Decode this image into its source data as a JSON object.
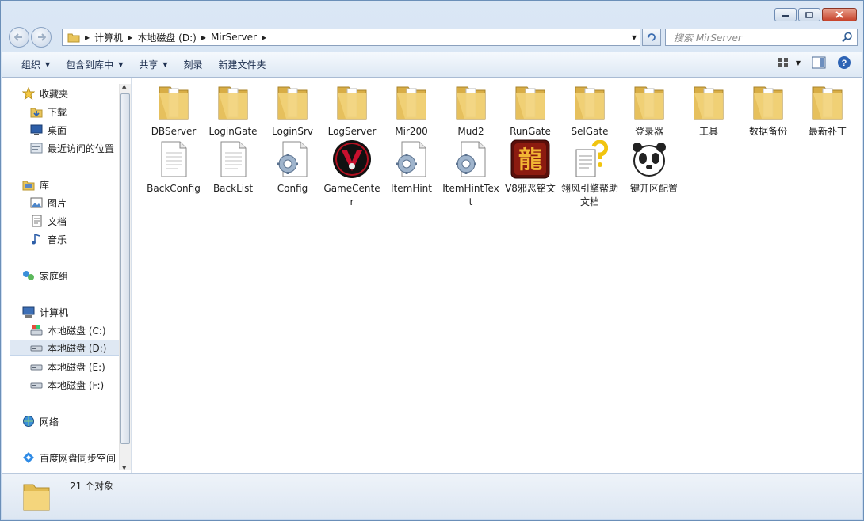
{
  "breadcrumbs": [
    "计算机",
    "本地磁盘 (D:)",
    "MirServer"
  ],
  "search": {
    "placeholder": "搜索 MirServer"
  },
  "toolbar": {
    "organize": "组织",
    "include_library": "包含到库中",
    "share": "共享",
    "burn": "刻录",
    "new_folder": "新建文件夹"
  },
  "sidebar": {
    "favorites": "收藏夹",
    "downloads": "下载",
    "desktop": "桌面",
    "recent": "最近访问的位置",
    "libraries": "库",
    "pictures": "图片",
    "documents": "文档",
    "music": "音乐",
    "homegroup": "家庭组",
    "computer": "计算机",
    "drive_c": "本地磁盘 (C:)",
    "drive_d": "本地磁盘 (D:)",
    "drive_e": "本地磁盘 (E:)",
    "drive_f": "本地磁盘 (F:)",
    "network": "网络",
    "baidu": "百度网盘同步空间"
  },
  "files": [
    {
      "name": "DBServer",
      "icon": "folder-icon"
    },
    {
      "name": "LoginGate",
      "icon": "folder-icon"
    },
    {
      "name": "LoginSrv",
      "icon": "folder-icon"
    },
    {
      "name": "LogServer",
      "icon": "folder-icon"
    },
    {
      "name": "Mir200",
      "icon": "folder-icon"
    },
    {
      "name": "Mud2",
      "icon": "folder-icon"
    },
    {
      "name": "RunGate",
      "icon": "folder-icon"
    },
    {
      "name": "SelGate",
      "icon": "folder-icon"
    },
    {
      "name": "登录器",
      "icon": "folder-icon"
    },
    {
      "name": "工具",
      "icon": "folder-icon"
    },
    {
      "name": "数据备份",
      "icon": "folder-icon"
    },
    {
      "name": "最新补丁",
      "icon": "folder-icon"
    },
    {
      "name": "BackConfig",
      "icon": "text-file-icon"
    },
    {
      "name": "BackList",
      "icon": "text-file-icon"
    },
    {
      "name": "Config",
      "icon": "config-file-icon"
    },
    {
      "name": "GameCenter",
      "icon": "gamecenter-app-icon"
    },
    {
      "name": "ItemHint",
      "icon": "config-file-icon"
    },
    {
      "name": "ItemHintText",
      "icon": "config-file-icon"
    },
    {
      "name": "V8邪恶铭文",
      "icon": "dragon-app-icon"
    },
    {
      "name": "翎风引擎帮助文档",
      "icon": "help-document-icon"
    },
    {
      "name": "一键开区配置",
      "icon": "panda-app-icon"
    }
  ],
  "status": {
    "count": "21 个对象"
  },
  "colors": {
    "folder": "#f1d37a",
    "accent": "#c7d9ef",
    "close": "#c7432b"
  }
}
